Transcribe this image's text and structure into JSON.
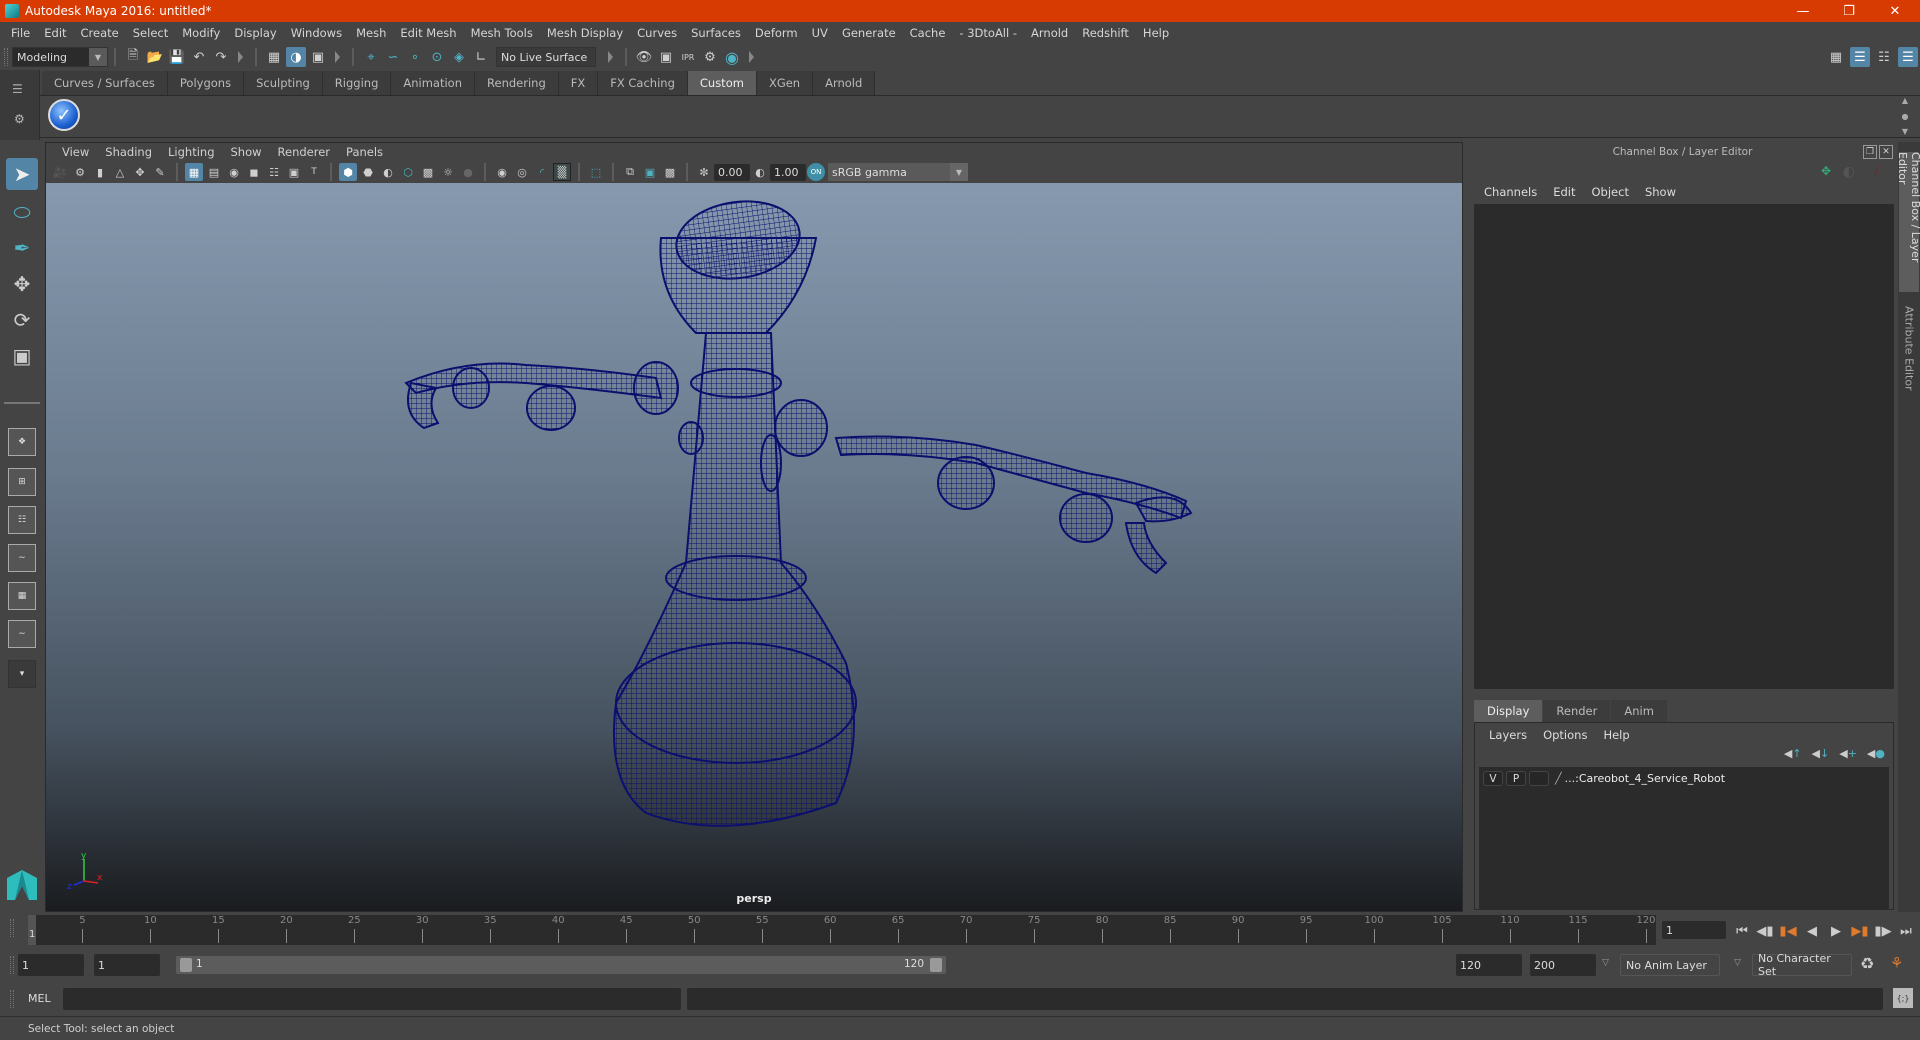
{
  "window": {
    "title": "Autodesk Maya 2016: untitled*",
    "controls": [
      "minimize",
      "restore",
      "close"
    ]
  },
  "menubar": [
    "File",
    "Edit",
    "Create",
    "Select",
    "Modify",
    "Display",
    "Windows",
    "Mesh",
    "Edit Mesh",
    "Mesh Tools",
    "Mesh Display",
    "Curves",
    "Surfaces",
    "Deform",
    "UV",
    "Generate",
    "Cache",
    "- 3DtoAll -",
    "Arnold",
    "Redshift",
    "Help"
  ],
  "statusline": {
    "menuset": "Modeling",
    "live_surface": "No Live Surface"
  },
  "shelf": {
    "tabs": [
      "Curves / Surfaces",
      "Polygons",
      "Sculpting",
      "Rigging",
      "Animation",
      "Rendering",
      "FX",
      "FX Caching",
      "Custom",
      "XGen",
      "Arnold"
    ],
    "active_tab": "Custom",
    "buttons": [
      "check-icon"
    ]
  },
  "viewport": {
    "menu": [
      "View",
      "Shading",
      "Lighting",
      "Show",
      "Renderer",
      "Panels"
    ],
    "exposure": "0.00",
    "gamma": "1.00",
    "color_mgmt": "ON",
    "color_space": "sRGB gamma",
    "camera": "persp",
    "axes": {
      "x": "x",
      "y": "y",
      "z": "z"
    },
    "wire_color": "#0b0f6e"
  },
  "right_panel": {
    "title": "Channel Box / Layer Editor",
    "menu": [
      "Channels",
      "Edit",
      "Object",
      "Show"
    ],
    "layer_tabs": [
      "Display",
      "Render",
      "Anim"
    ],
    "active_layer_tab": "Display",
    "layer_menu": [
      "Layers",
      "Options",
      "Help"
    ],
    "layers": [
      {
        "v": "V",
        "p": "P",
        "name": "...:Careobot_4_Service_Robot"
      }
    ],
    "side_tabs": [
      "Channel Box / Layer Editor",
      "Attribute Editor"
    ]
  },
  "timeline": {
    "ticks": [
      5,
      10,
      15,
      20,
      25,
      30,
      35,
      40,
      45,
      50,
      55,
      60,
      65,
      70,
      75,
      80,
      85,
      90,
      95,
      100,
      105,
      110,
      115,
      120
    ],
    "start": 1,
    "end": 120,
    "current_frame_marker": "1",
    "current_frame": "1"
  },
  "range": {
    "start_time": "1",
    "playback_start": "1",
    "slider_start": "1",
    "slider_end": "120",
    "playback_end": "120",
    "end_time": "200",
    "anim_layer": "No Anim Layer",
    "character_set": "No Character Set"
  },
  "command_line": {
    "label": "MEL",
    "value": ""
  },
  "help_line": "Select Tool: select an object"
}
